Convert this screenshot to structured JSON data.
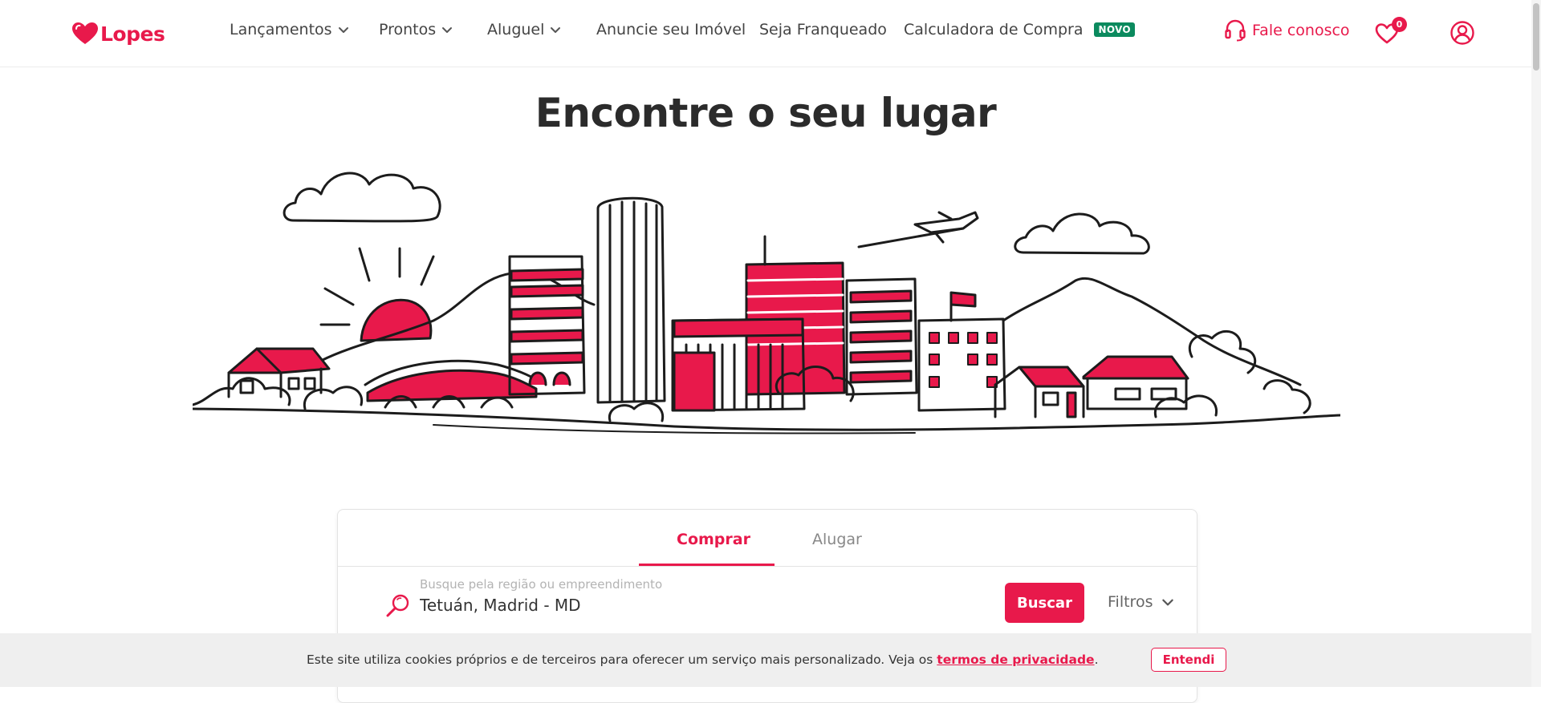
{
  "brand": {
    "name": "Lopes",
    "color": "#e8194b"
  },
  "nav": [
    {
      "label": "Lançamentos",
      "dropdown": true
    },
    {
      "label": "Prontos",
      "dropdown": true
    },
    {
      "label": "Aluguel",
      "dropdown": true
    },
    {
      "label": "Anuncie seu Imóvel",
      "dropdown": false
    },
    {
      "label": "Seja Franqueado",
      "dropdown": false
    },
    {
      "label": "Calculadora de Compra",
      "dropdown": false,
      "badge": "NOVO"
    }
  ],
  "header": {
    "contact_label": "Fale conosco",
    "contact_icon": "headset-icon",
    "favorites_icon": "heart-icon",
    "favorites_count": "0",
    "user_icon": "user-circle-icon"
  },
  "hero": {
    "title": "Encontre o seu lugar"
  },
  "search": {
    "tabs": [
      {
        "label": "Comprar",
        "active": true
      },
      {
        "label": "Alugar",
        "active": false
      }
    ],
    "hint": "Busque pela região ou empreendimento",
    "value": "Tetuán, Madrid - MD",
    "submit_label": "Buscar",
    "filters_label": "Filtros"
  },
  "cookie": {
    "text": "Este site utiliza cookies próprios e de terceiros para oferecer um serviço mais personalizado. Veja os ",
    "link_label": "termos de privacidade",
    "suffix": ".",
    "button_label": "Entendi"
  },
  "colors": {
    "accent": "#e8194b",
    "badge_green": "#0b8a5e",
    "text": "#333333"
  }
}
